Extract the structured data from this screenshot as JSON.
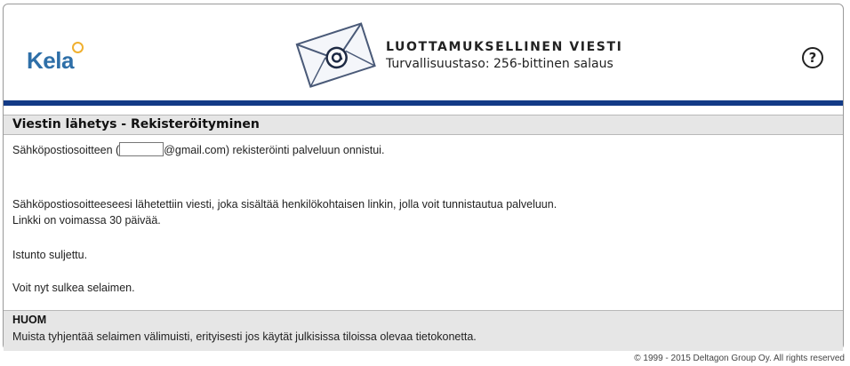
{
  "header": {
    "logo_text": "Kela",
    "title": "LUOTTAMUKSELLINEN VIESTI",
    "subtitle": "Turvallisuustaso: 256-bittinen salaus",
    "help_symbol": "?"
  },
  "section": {
    "title": "Viestin lähetys - Rekisteröityminen"
  },
  "messages": {
    "registration_prefix": "Sähköpostiosoitteen (",
    "registration_suffix": "@gmail.com) rekisteröinti palveluun onnistui.",
    "link_sent": "Sähköpostiosoitteeseesi lähetettiin viesti, joka sisältää henkilökohtaisen linkin, jolla voit tunnistautua palveluun.",
    "link_valid": "Linkki on voimassa 30 päivää.",
    "session_closed": "Istunto suljettu.",
    "close_browser": "Voit nyt sulkea selaimen."
  },
  "note": {
    "title": "HUOM",
    "text": "Muista tyhjentää selaimen välimuisti, erityisesti jos käytät julkisissa tiloissa olevaa tietokonetta."
  },
  "footer": {
    "copyright": "© 1999 - 2015 Deltagon Group Oy. All rights reserved"
  },
  "colors": {
    "brand_blue": "#2e6fa8",
    "bar_navy": "#123a86",
    "logo_accent": "#f0b030",
    "panel_gray": "#e6e6e6"
  }
}
